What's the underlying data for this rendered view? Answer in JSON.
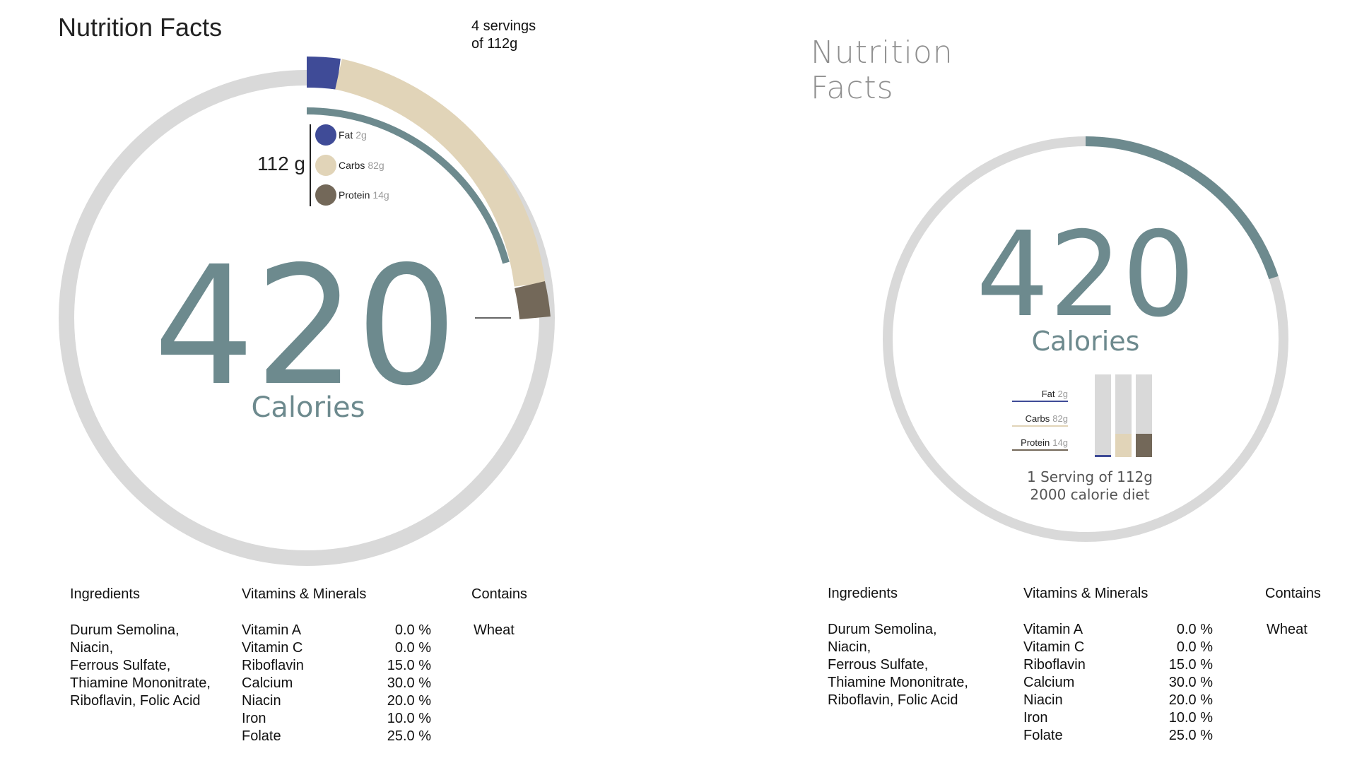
{
  "left": {
    "title": "Nutrition Facts",
    "servings_line1": "4 servings",
    "servings_line2": "of 112g",
    "weight_label": "112 g",
    "calories_value": "420",
    "calories_label": "Calories"
  },
  "right": {
    "title_line1": "Nutrition",
    "title_line2": "Facts",
    "calories_value": "420",
    "calories_label": "Calories",
    "serving_line1": "1 Serving of 112g",
    "serving_line2": "2000 calorie diet"
  },
  "macros": [
    {
      "name": "Fat",
      "amount": "2g",
      "color": "#3f4b97"
    },
    {
      "name": "Carbs",
      "amount": "82g",
      "color": "#e1d4b8"
    },
    {
      "name": "Protein",
      "amount": "14g",
      "color": "#736859"
    }
  ],
  "colors": {
    "ring_track": "#d9d9d9",
    "calorie_accent": "#6d8a8e"
  },
  "sections": {
    "ingredients_heading": "Ingredients",
    "vitamins_heading": "Vitamins & Minerals",
    "contains_heading": "Contains"
  },
  "ingredients": [
    "Durum Semolina,",
    "Niacin,",
    "Ferrous Sulfate,",
    "Thiamine Mononitrate,",
    "Riboflavin, Folic Acid"
  ],
  "vitamins": [
    {
      "name": "Vitamin A",
      "value": "0.0 %"
    },
    {
      "name": "Vitamin C",
      "value": "0.0 %"
    },
    {
      "name": "Riboflavin",
      "value": "15.0 %"
    },
    {
      "name": "Calcium",
      "value": "30.0 %"
    },
    {
      "name": "Niacin",
      "value": "20.0 %"
    },
    {
      "name": "Iron",
      "value": "10.0 %"
    },
    {
      "name": "Folate",
      "value": "25.0 %"
    }
  ],
  "contains": "Wheat"
}
